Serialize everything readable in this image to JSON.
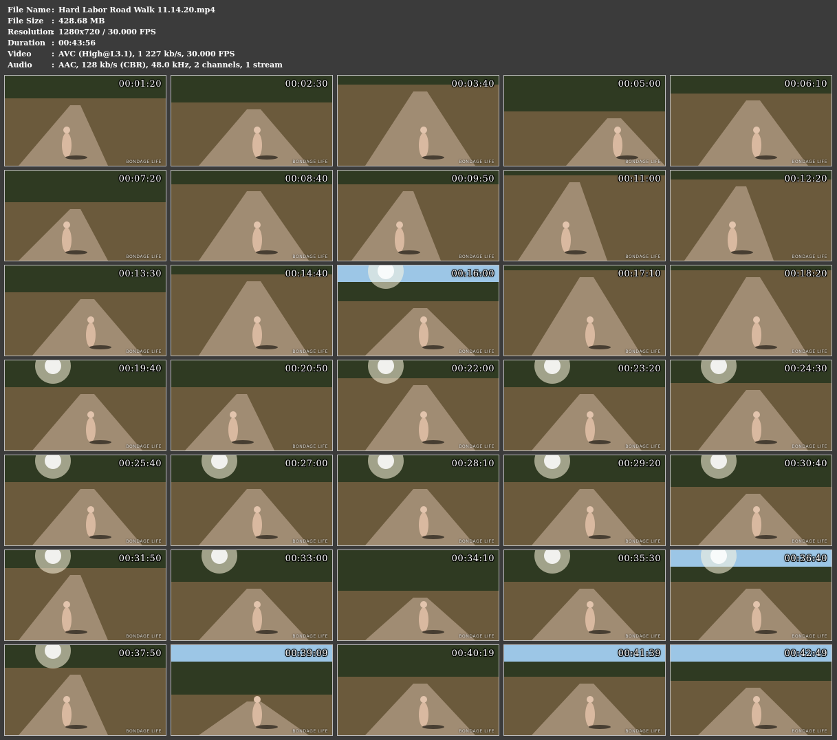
{
  "info": [
    {
      "key": "File Name",
      "sep": ":",
      "value": "Hard Labor Road Walk 11.14.20.mp4"
    },
    {
      "key": "File Size",
      "sep": ":",
      "value": "428.68 MB"
    },
    {
      "key": "Resolution",
      "sep": ":",
      "value": "1280x720 / 30.000 FPS"
    },
    {
      "key": "Duration",
      "sep": ":",
      "value": "00:43:56"
    },
    {
      "key": "Video",
      "sep": ":",
      "value": "AVC (High@L3.1), 1 227 kb/s, 30.000 FPS"
    },
    {
      "key": "Audio",
      "sep": ":",
      "value": "AAC, 128 kb/s (CBR), 48.0 kHz, 2 channels, 1 stream"
    }
  ],
  "thumbnails": [
    {
      "time": "00:01:20",
      "watermark": "BONDAGE LIFE"
    },
    {
      "time": "00:02:30",
      "watermark": "BONDAGE LIFE"
    },
    {
      "time": "00:03:40",
      "watermark": "BONDAGE LIFE"
    },
    {
      "time": "00:05:00",
      "watermark": "BONDAGE LIFE"
    },
    {
      "time": "00:06:10",
      "watermark": "BONDAGE LIFE"
    },
    {
      "time": "00:07:20",
      "watermark": "BONDAGE LIFE"
    },
    {
      "time": "00:08:40",
      "watermark": "BONDAGE LIFE"
    },
    {
      "time": "00:09:50",
      "watermark": "BONDAGE LIFE"
    },
    {
      "time": "00:11:00",
      "watermark": "BONDAGE LIFE"
    },
    {
      "time": "00:12:20",
      "watermark": "BONDAGE LIFE"
    },
    {
      "time": "00:13:30",
      "watermark": "BONDAGE LIFE"
    },
    {
      "time": "00:14:40",
      "watermark": "BONDAGE LIFE"
    },
    {
      "time": "00:16:00",
      "watermark": "BONDAGE LIFE"
    },
    {
      "time": "00:17:10",
      "watermark": "BONDAGE LIFE"
    },
    {
      "time": "00:18:20",
      "watermark": "BONDAGE LIFE"
    },
    {
      "time": "00:19:40",
      "watermark": "BONDAGE LIFE"
    },
    {
      "time": "00:20:50",
      "watermark": "BONDAGE LIFE"
    },
    {
      "time": "00:22:00",
      "watermark": "BONDAGE LIFE"
    },
    {
      "time": "00:23:20",
      "watermark": "BONDAGE LIFE"
    },
    {
      "time": "00:24:30",
      "watermark": "BONDAGE LIFE"
    },
    {
      "time": "00:25:40",
      "watermark": "BONDAGE LIFE"
    },
    {
      "time": "00:27:00",
      "watermark": "BONDAGE LIFE"
    },
    {
      "time": "00:28:10",
      "watermark": "BONDAGE LIFE"
    },
    {
      "time": "00:29:20",
      "watermark": "BONDAGE LIFE"
    },
    {
      "time": "00:30:40",
      "watermark": "BONDAGE LIFE"
    },
    {
      "time": "00:31:50",
      "watermark": "BONDAGE LIFE"
    },
    {
      "time": "00:33:00",
      "watermark": "BONDAGE LIFE"
    },
    {
      "time": "00:34:10",
      "watermark": "BONDAGE LIFE"
    },
    {
      "time": "00:35:30",
      "watermark": "BONDAGE LIFE"
    },
    {
      "time": "00:36:40",
      "watermark": "BONDAGE LIFE"
    },
    {
      "time": "00:37:50",
      "watermark": "BONDAGE LIFE"
    },
    {
      "time": "00:39:09",
      "watermark": "BONDAGE LIFE"
    },
    {
      "time": "00:40:19",
      "watermark": "BONDAGE LIFE"
    },
    {
      "time": "00:41:39",
      "watermark": "BONDAGE LIFE"
    },
    {
      "time": "00:42:49",
      "watermark": "BONDAGE LIFE"
    }
  ],
  "colors": {
    "background": "#3b3b3b",
    "text": "#ffffff",
    "thumb_border": "#bdbdbd",
    "road": "#a08c73",
    "brush": "#6b5a3c",
    "trees": "#2f3a22",
    "sky": "#9cc6e6"
  }
}
